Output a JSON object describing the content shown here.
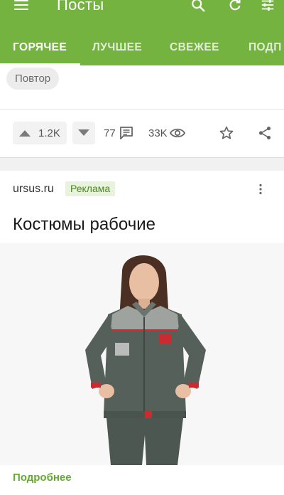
{
  "header": {
    "title": "Посты",
    "icons": [
      "menu-icon",
      "search-icon",
      "refresh-icon",
      "filter-icon"
    ]
  },
  "tabs": [
    {
      "label": "ГОРЯЧЕЕ",
      "active": true
    },
    {
      "label": "ЛУЧШЕЕ",
      "active": false
    },
    {
      "label": "СВЕЖЕЕ",
      "active": false
    },
    {
      "label": "ПОДП",
      "active": false
    }
  ],
  "post": {
    "tag": "Повтор",
    "rating": "1.2K",
    "comments": "77",
    "views": "33K"
  },
  "ad": {
    "source": "ursus.ru",
    "badge": "Реклама",
    "title": "Костюмы рабочие",
    "more_label": "Подробнее",
    "image_subject": "woman-in-grey-work-suit"
  },
  "colors": {
    "brand_green": "#74b33f",
    "ad_badge_bg": "#e7f3dc",
    "ad_badge_text": "#4a8a1e",
    "more_link": "#65a833"
  }
}
